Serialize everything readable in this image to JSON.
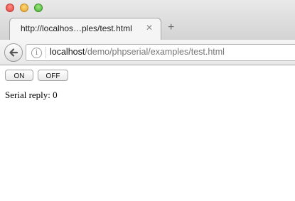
{
  "browser": {
    "tab": {
      "title": "http://localhos…ples/test.html",
      "close_glyph": "✕"
    },
    "new_tab_glyph": "+",
    "address": {
      "host": "localhost",
      "path": "/demo/phpserial/examples/test.html",
      "info_glyph": "i"
    }
  },
  "page": {
    "on_button": "ON",
    "off_button": "OFF",
    "serial_label": "Serial reply:",
    "serial_value": "0"
  }
}
